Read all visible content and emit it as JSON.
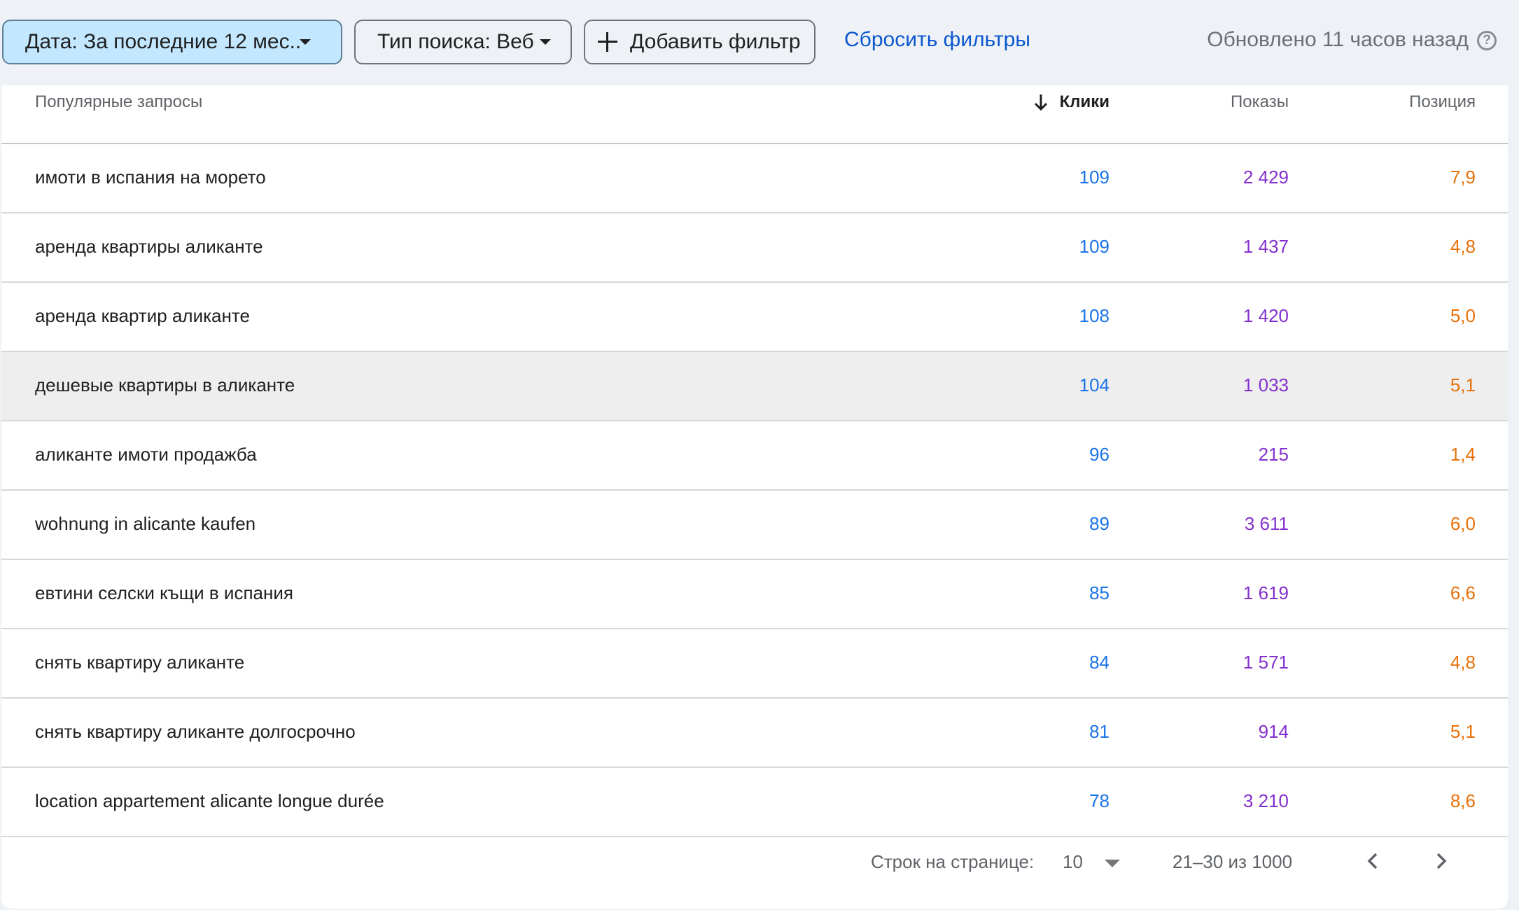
{
  "filters": {
    "date_chip": "Дата: За последние 12 мес...",
    "type_chip": "Тип поиска: Веб",
    "add_filter": "Добавить фильтр",
    "reset": "Сбросить фильтры",
    "updated": "Обновлено 11 часов назад",
    "help_glyph": "?"
  },
  "table": {
    "headers": {
      "query": "Популярные запросы",
      "clicks": "Клики",
      "impressions": "Показы",
      "position": "Позиция"
    },
    "sorted_by": "clicks",
    "sort_direction": "descending",
    "hovered_row": 3,
    "rows": [
      {
        "query": "имоти в испания на морето",
        "clicks": "109",
        "impressions": "2 429",
        "position": "7,9"
      },
      {
        "query": "аренда квартиры аликанте",
        "clicks": "109",
        "impressions": "1 437",
        "position": "4,8"
      },
      {
        "query": "аренда квартир аликанте",
        "clicks": "108",
        "impressions": "1 420",
        "position": "5,0"
      },
      {
        "query": "дешевые квартиры в аликанте",
        "clicks": "104",
        "impressions": "1 033",
        "position": "5,1"
      },
      {
        "query": "аликанте имоти продажба",
        "clicks": "96",
        "impressions": "215",
        "position": "1,4"
      },
      {
        "query": "wohnung in alicante kaufen",
        "clicks": "89",
        "impressions": "3 611",
        "position": "6,0"
      },
      {
        "query": "евтини селски къщи в испания",
        "clicks": "85",
        "impressions": "1 619",
        "position": "6,6"
      },
      {
        "query": "снять квартиру аликанте",
        "clicks": "84",
        "impressions": "1 571",
        "position": "4,8"
      },
      {
        "query": "снять квартиру аликанте долгосрочно",
        "clicks": "81",
        "impressions": "914",
        "position": "5,1"
      },
      {
        "query": "location appartement alicante longue durée",
        "clicks": "78",
        "impressions": "3 210",
        "position": "8,6"
      }
    ]
  },
  "pagination": {
    "rows_label": "Строк на странице:",
    "rows_value": "10",
    "range": "21–30 из 1000"
  },
  "colors": {
    "clicks": "#1a73e8",
    "impressions": "#8430ce",
    "position": "#e8710a",
    "date_chip_bg": "#c2e7ff",
    "link": "#0b57d0"
  },
  "icons": {
    "date_dropdown": "caret-down-icon",
    "type_dropdown": "caret-down-icon",
    "add_filter": "plus-icon",
    "help": "help-circle-icon",
    "sort": "arrow-down-icon",
    "prev": "chevron-left-icon",
    "next": "chevron-right-icon"
  }
}
